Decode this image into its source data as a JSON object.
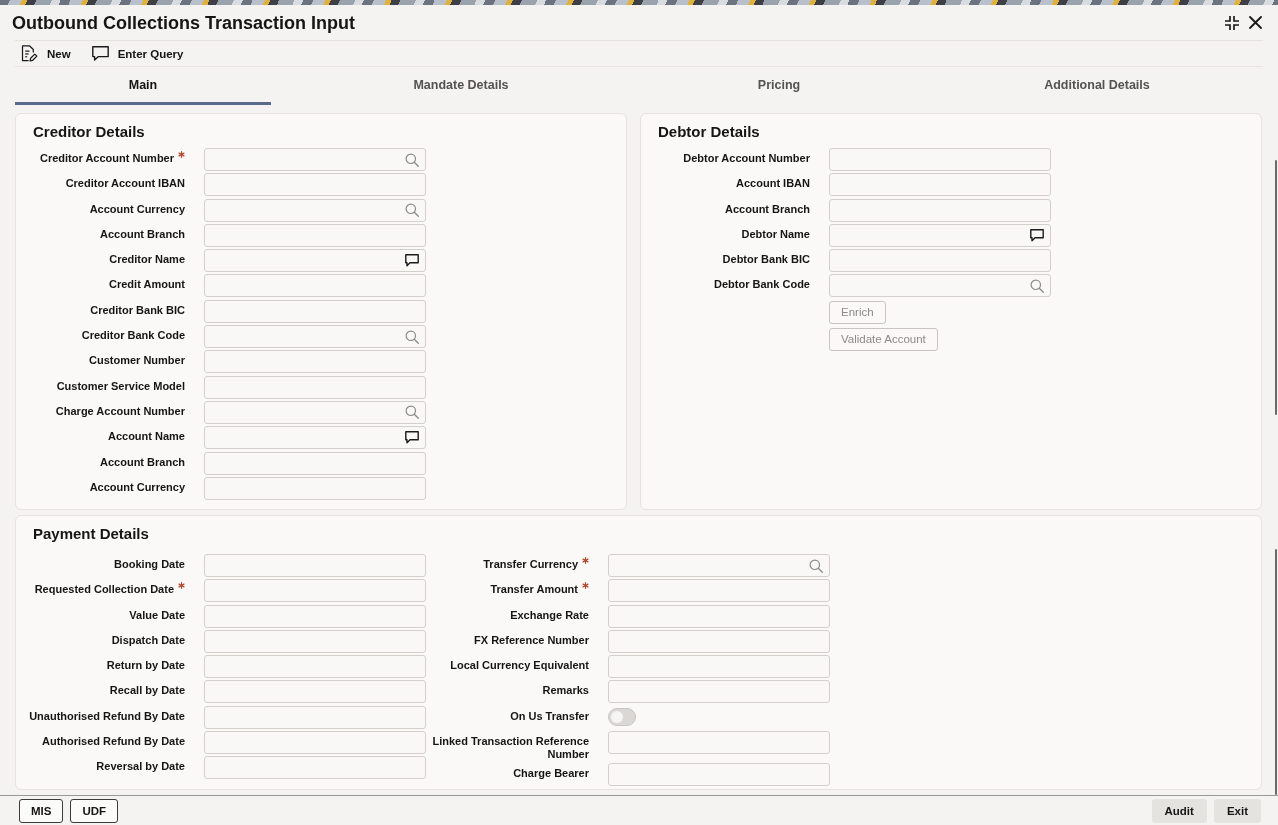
{
  "window": {
    "title": "Outbound Collections Transaction Input"
  },
  "toolbar": [
    {
      "label": "New",
      "kind": "new"
    },
    {
      "label": "Enter Query",
      "kind": "query"
    }
  ],
  "tabs": [
    {
      "label": "Main",
      "selected": true
    },
    {
      "label": "Mandate Details",
      "selected": false
    },
    {
      "label": "Pricing",
      "selected": false
    },
    {
      "label": "Additional Details",
      "selected": false
    }
  ],
  "creditor_details": {
    "title": "Creditor Details",
    "fields": [
      {
        "label": "Creditor Account Number",
        "kind": "search",
        "required": true
      },
      {
        "label": "Creditor Account IBAN",
        "kind": "text",
        "required": false
      },
      {
        "label": "Account Currency",
        "kind": "search",
        "required": false
      },
      {
        "label": "Account Branch",
        "kind": "text",
        "required": false
      },
      {
        "label": "Creditor Name",
        "kind": "comment",
        "required": false
      },
      {
        "label": "Credit Amount",
        "kind": "text",
        "required": false
      },
      {
        "label": "Creditor Bank BIC",
        "kind": "text",
        "required": false
      },
      {
        "label": "Creditor Bank Code",
        "kind": "search",
        "required": false
      },
      {
        "label": "Customer Number",
        "kind": "text",
        "required": false
      },
      {
        "label": "Customer Service Model",
        "kind": "text",
        "required": false
      },
      {
        "label": "Charge Account Number",
        "kind": "search",
        "required": false
      },
      {
        "label": "Account Name",
        "kind": "comment",
        "required": false
      },
      {
        "label": "Account Branch",
        "kind": "text",
        "required": false
      },
      {
        "label": "Account Currency",
        "kind": "text",
        "required": false
      }
    ]
  },
  "debtor_details": {
    "title": "Debtor Details",
    "fields": [
      {
        "label": "Debtor Account Number",
        "kind": "text",
        "required": false
      },
      {
        "label": "Account IBAN",
        "kind": "text",
        "required": false
      },
      {
        "label": "Account Branch",
        "kind": "text",
        "required": false
      },
      {
        "label": "Debtor Name",
        "kind": "comment",
        "required": false
      },
      {
        "label": "Debtor Bank BIC",
        "kind": "text",
        "required": false
      },
      {
        "label": "Debtor Bank Code",
        "kind": "search",
        "required": false
      }
    ],
    "buttons": [
      {
        "label": "Enrich",
        "disabled": true
      },
      {
        "label": "Validate Account",
        "disabled": true
      }
    ]
  },
  "payment_details": {
    "title": "Payment Details",
    "left_fields": [
      {
        "label": "Booking Date",
        "kind": "text",
        "required": false
      },
      {
        "label": "Requested Collection Date",
        "kind": "text",
        "required": true
      },
      {
        "label": "Value Date",
        "kind": "text",
        "required": false
      },
      {
        "label": "Dispatch Date",
        "kind": "text",
        "required": false
      },
      {
        "label": "Return by Date",
        "kind": "text",
        "required": false
      },
      {
        "label": "Recall by Date",
        "kind": "text",
        "required": false
      },
      {
        "label": "Unauthorised Refund By Date",
        "kind": "text",
        "required": false
      },
      {
        "label": "Authorised Refund By Date",
        "kind": "text",
        "required": false
      },
      {
        "label": "Reversal by Date",
        "kind": "text",
        "required": false
      }
    ],
    "right_fields": [
      {
        "label": "Transfer Currency",
        "kind": "search",
        "required": true
      },
      {
        "label": "Transfer Amount",
        "kind": "text",
        "required": true
      },
      {
        "label": "Exchange Rate",
        "kind": "text",
        "required": false
      },
      {
        "label": "FX Reference Number",
        "kind": "text",
        "required": false
      },
      {
        "label": "Local Currency Equivalent",
        "kind": "text",
        "required": false
      },
      {
        "label": "Remarks",
        "kind": "text",
        "required": false
      },
      {
        "label": "On Us Transfer",
        "kind": "toggle",
        "required": false,
        "on": false
      },
      {
        "label": "Linked Transaction Reference Number",
        "kind": "text",
        "required": false
      },
      {
        "label": "Charge Bearer",
        "kind": "text",
        "required": false
      }
    ]
  },
  "footer": {
    "left_buttons": [
      {
        "label": "MIS"
      },
      {
        "label": "UDF"
      }
    ],
    "right_buttons": [
      {
        "label": "Audit"
      },
      {
        "label": "Exit"
      }
    ]
  }
}
